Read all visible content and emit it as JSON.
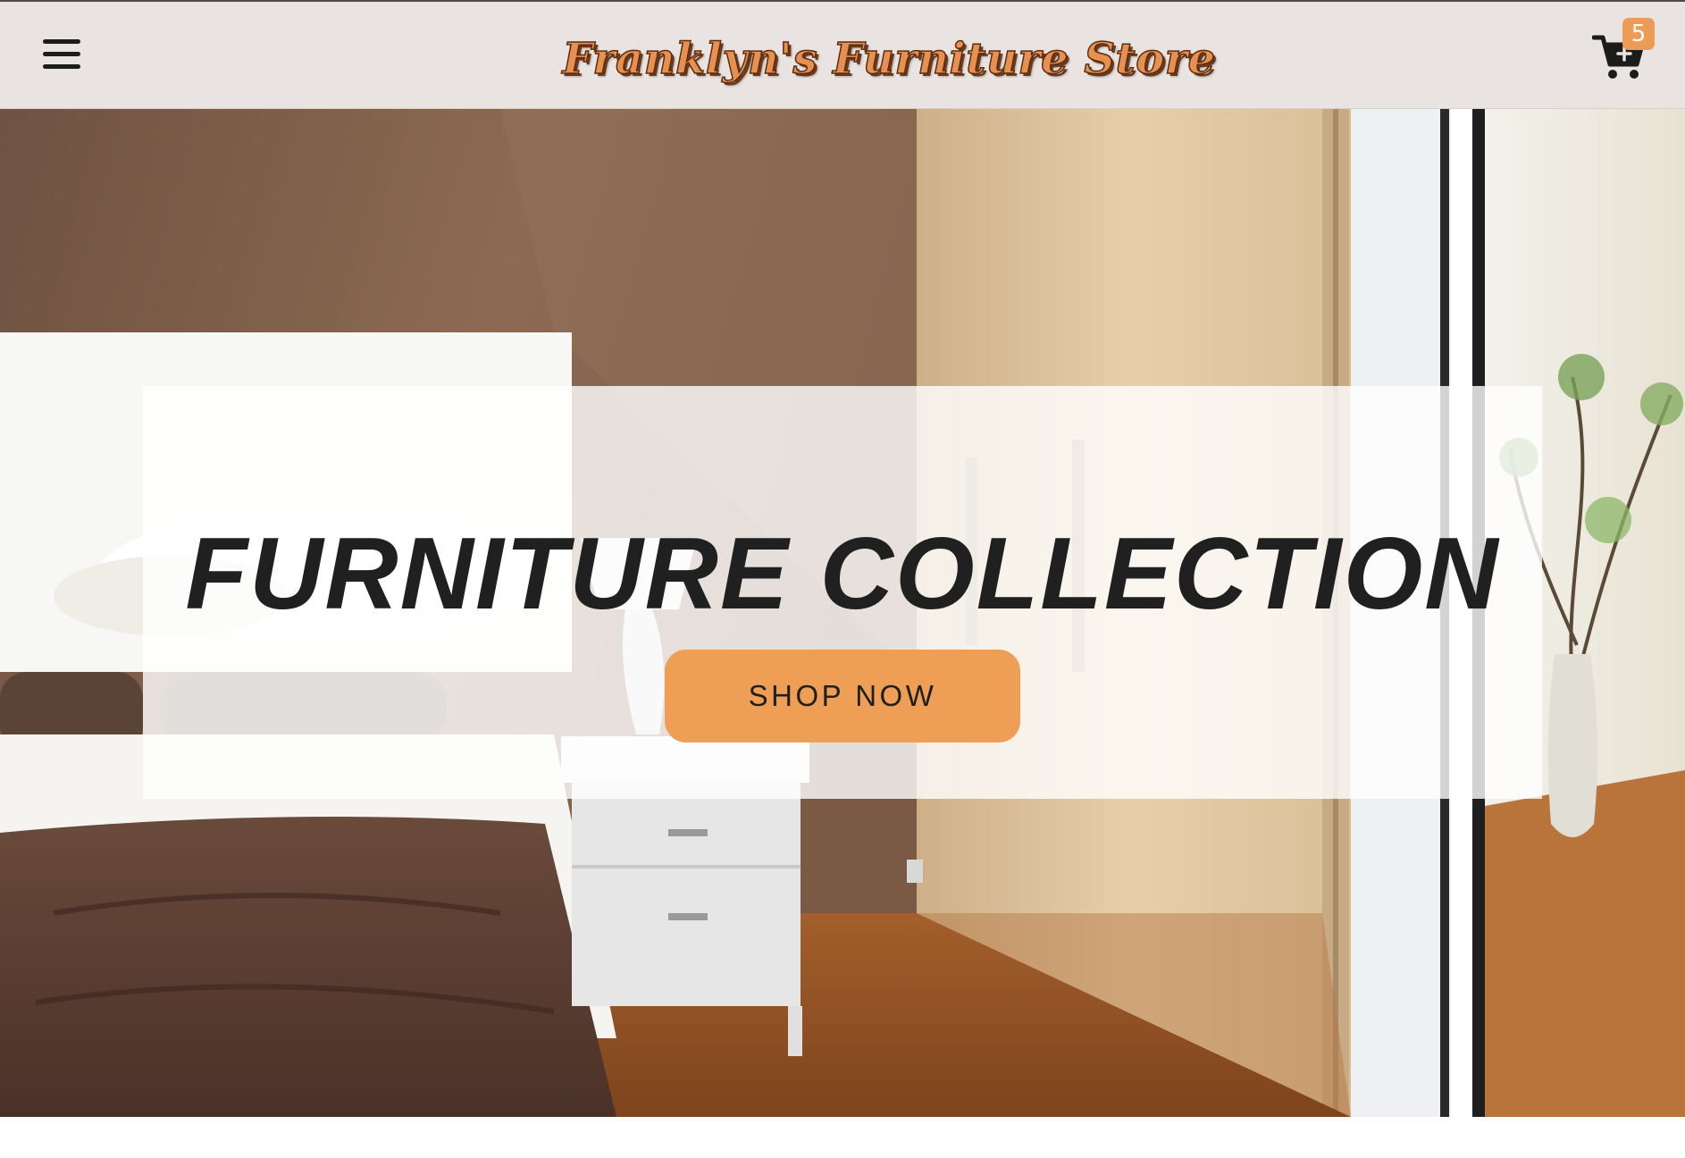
{
  "header": {
    "menu_icon": "hamburger-menu-icon",
    "brand": "Franklyn's Furniture Store",
    "cart": {
      "icon": "shopping-cart-plus-icon",
      "count": "5"
    }
  },
  "hero": {
    "image": "bedroom-photo",
    "title": "FURNITURE COLLECTION",
    "cta": "SHOP NOW"
  },
  "colors": {
    "accent": "#ef9e55",
    "header_bg": "#e9e4e1",
    "brand_text": "#e8904f",
    "title_text": "#202020"
  }
}
